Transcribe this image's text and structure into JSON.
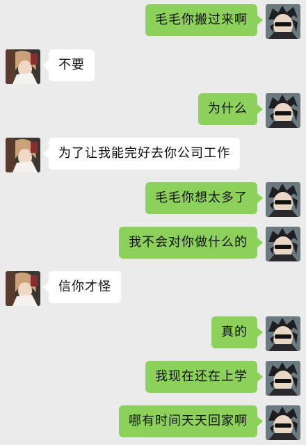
{
  "colors": {
    "background": "#ebebeb",
    "sent_bubble": "#8bd15a",
    "received_bubble": "#ffffff"
  },
  "messages": [
    {
      "side": "right",
      "text": "毛毛你搬过来啊"
    },
    {
      "side": "left",
      "text": "不要"
    },
    {
      "side": "right",
      "text": "为什么"
    },
    {
      "side": "left",
      "text": "为了让我能完好去你公司工作"
    },
    {
      "side": "right",
      "text": "毛毛你想太多了"
    },
    {
      "side": "right",
      "text": "我不会对你做什么的"
    },
    {
      "side": "left",
      "text": "信你才怪"
    },
    {
      "side": "right",
      "text": "真的"
    },
    {
      "side": "right",
      "text": "我现在还在上学"
    },
    {
      "side": "right",
      "text": "哪有时间天天回家啊"
    }
  ]
}
